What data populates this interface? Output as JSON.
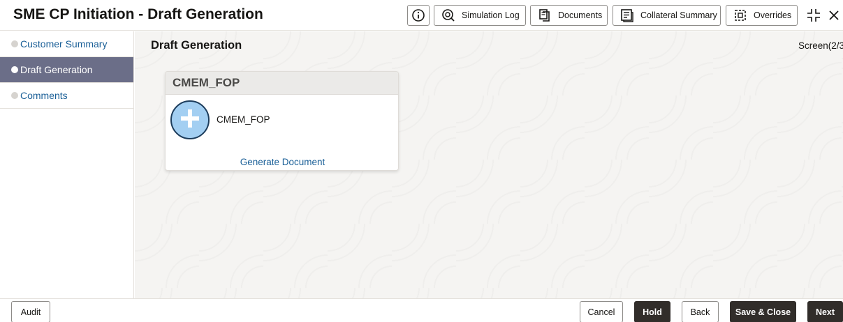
{
  "header": {
    "title": "SME CP Initiation - Draft Generation",
    "buttons": {
      "simulation_log": "Simulation Log",
      "documents": "Documents",
      "collateral_summary": "Collateral Summary",
      "overrides": "Overrides"
    },
    "icons": [
      "info-icon",
      "simulation-log-icon",
      "documents-icon",
      "collateral-summary-icon",
      "overrides-icon",
      "shrink-icon",
      "close-icon"
    ]
  },
  "sidebar": {
    "items": [
      {
        "label": "Customer Summary",
        "active": false
      },
      {
        "label": "Draft Generation",
        "active": true
      },
      {
        "label": "Comments",
        "active": false
      }
    ]
  },
  "main": {
    "title": "Draft Generation",
    "screen_indicator": "Screen(2/3",
    "card": {
      "header": "CMEM_FOP",
      "document_name": "CMEM_FOP",
      "action_link": "Generate Document",
      "icon": "add-icon"
    }
  },
  "footer": {
    "audit": "Audit",
    "cancel": "Cancel",
    "hold": "Hold",
    "back": "Back",
    "save_close": "Save & Close",
    "next": "Next"
  },
  "colors": {
    "active_nav_bg": "#6b6e88",
    "link": "#1a5f97",
    "dark_button": "#312d2a",
    "add_button_fill": "#a3cff2"
  }
}
